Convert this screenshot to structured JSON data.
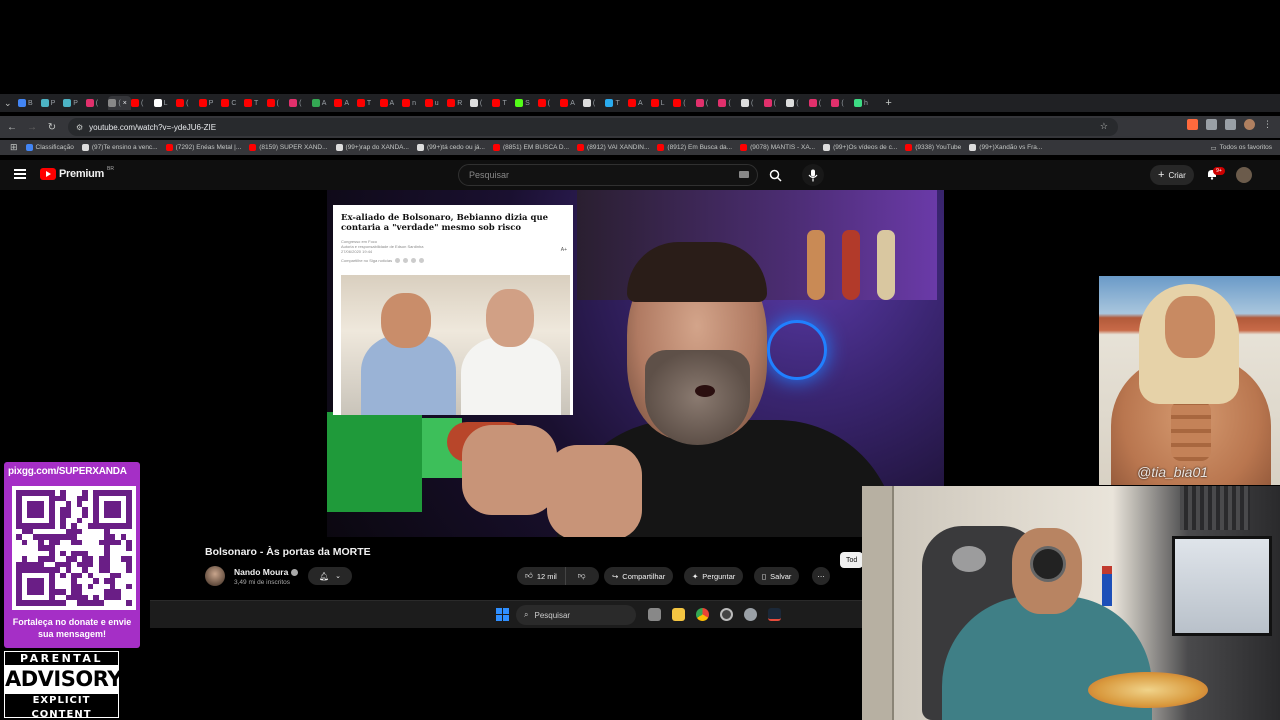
{
  "browser": {
    "url": "youtube.com/watch?v=-ydeJU6-ZIE",
    "tabs": [
      {
        "label": "B",
        "color": "#4285f4"
      },
      {
        "label": "P",
        "color": "#4cb3c4"
      },
      {
        "label": "P",
        "color": "#4cb3c4"
      },
      {
        "label": "(",
        "color": "#e1306c"
      },
      {
        "label": "(",
        "color": "#888888"
      },
      {
        "label": "(",
        "color": "#ff0000"
      },
      {
        "label": "L",
        "color": "#ffffff"
      },
      {
        "label": "(",
        "color": "#ff0000"
      },
      {
        "label": "P",
        "color": "#ff0000"
      },
      {
        "label": "C",
        "color": "#ff0000"
      },
      {
        "label": "T",
        "color": "#ff0000"
      },
      {
        "label": "(",
        "color": "#ff0000"
      },
      {
        "label": "(",
        "color": "#e1306c"
      },
      {
        "label": "A",
        "color": "#34a853"
      },
      {
        "label": "A",
        "color": "#ff0000"
      },
      {
        "label": "T",
        "color": "#ff0000"
      },
      {
        "label": "A",
        "color": "#ff0000"
      },
      {
        "label": "n",
        "color": "#ff0000"
      },
      {
        "label": "u",
        "color": "#ff0000"
      },
      {
        "label": "R",
        "color": "#ff0000"
      },
      {
        "label": "(",
        "color": "#dddddd"
      },
      {
        "label": "T",
        "color": "#ff0000"
      },
      {
        "label": "S",
        "color": "#53fc18"
      },
      {
        "label": "(",
        "color": "#ff0000"
      },
      {
        "label": "A",
        "color": "#ff0000"
      },
      {
        "label": "(",
        "color": "#dddddd"
      },
      {
        "label": "T",
        "color": "#2aabee"
      },
      {
        "label": "A",
        "color": "#ff0000"
      },
      {
        "label": "L",
        "color": "#ff0000"
      },
      {
        "label": "(",
        "color": "#ff0000"
      },
      {
        "label": "(",
        "color": "#e1306c"
      },
      {
        "label": "(",
        "color": "#e1306c"
      },
      {
        "label": "(",
        "color": "#dddddd"
      },
      {
        "label": "(",
        "color": "#e1306c"
      },
      {
        "label": "(",
        "color": "#dddddd"
      },
      {
        "label": "(",
        "color": "#e1306c"
      },
      {
        "label": "(",
        "color": "#e1306c"
      },
      {
        "label": "h",
        "color": "#3ddc84"
      }
    ],
    "bookmarks": [
      {
        "label": "Classificação",
        "color": "#4285f4"
      },
      {
        "label": "(97)Te ensino a venc...",
        "color": "#dddddd"
      },
      {
        "label": "(7292) Enéas Metal |...",
        "color": "#ff0000"
      },
      {
        "label": "(8159) SUPER XAND...",
        "color": "#ff0000"
      },
      {
        "label": "(99+)rap do XANDÃ...",
        "color": "#dddddd"
      },
      {
        "label": "(99+)tá cedo ou já...",
        "color": "#dddddd"
      },
      {
        "label": "(8851) EM BUSCA D...",
        "color": "#ff0000"
      },
      {
        "label": "(8912) VAI XANDIN...",
        "color": "#ff0000"
      },
      {
        "label": "(8912) Em Busca da...",
        "color": "#ff0000"
      },
      {
        "label": "(9078) MANTIS - XA...",
        "color": "#ff0000"
      },
      {
        "label": "(99+)Os vídeos de c...",
        "color": "#dddddd"
      },
      {
        "label": "(9338) YouTube",
        "color": "#ff0000"
      },
      {
        "label": "(99+)Xandão vs Fra...",
        "color": "#dddddd"
      }
    ],
    "all_bookmarks_label": "Todos os favoritos"
  },
  "youtube": {
    "logo_text": "Premium",
    "logo_country": "BR",
    "search_placeholder": "Pesquisar",
    "create_label": "Criar",
    "notifications_badge": "9+",
    "video": {
      "title": "Bolsonaro - Às portas da MORTE",
      "channel_name": "Nando Moura",
      "subscribers": "3,49 mi de inscritos",
      "likes": "12 mil",
      "share_label": "Compartilhar",
      "ask_label": "Perguntar",
      "save_label": "Salvar",
      "todos_chip": "Tod"
    },
    "article": {
      "headline": "Ex-aliado de Bolsonaro, Bebianno dizia que contaria a \"verdade\" mesmo sob risco",
      "meta_line1": "Congresso em Foco",
      "meta_line2": "Autoria e responsabilidade de Edson Sardinha",
      "meta_line3": "27/06/2020 19:44",
      "share_text": "Compartilhe no Siga notícias",
      "font_size_label": "A+"
    }
  },
  "taskbar": {
    "search_placeholder": "Pesquisar"
  },
  "overlays": {
    "donate_url": "pixgg.com/SUPERXANDA",
    "donate_caption": "Fortaleça no donate e envie sua mensagem!",
    "advisory_top": "PARENTAL",
    "advisory_middle": "ADVISORY",
    "advisory_bottom": "EXPLICIT CONTENT",
    "meme_handle": "@tia_bia01"
  },
  "colors": {
    "youtube_red": "#ff0000",
    "donate_purple": "#a52fc6",
    "chrome_dark": "#202124"
  }
}
